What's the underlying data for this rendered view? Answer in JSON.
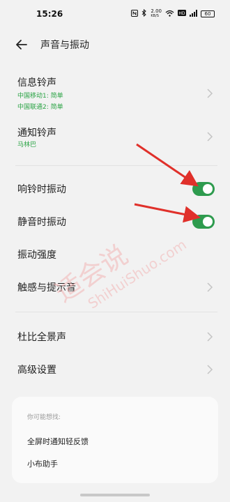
{
  "status_bar": {
    "time": "15:26",
    "speed_value": "2.00",
    "speed_unit": "KB/S",
    "battery": "60",
    "icons": [
      "nfc-icon",
      "bluetooth-icon",
      "wifi-icon",
      "hd-icon",
      "signal-icon",
      "battery-icon"
    ]
  },
  "header": {
    "title": "声音与振动"
  },
  "rows": {
    "message_ringtone": {
      "title": "信息铃声",
      "sub1": "中国移动1: 简单",
      "sub2": "中国联通2: 简单"
    },
    "notification_ringtone": {
      "title": "通知铃声",
      "sub": "马林巴"
    },
    "vibrate_on_ring": {
      "title": "响铃时振动",
      "on": true
    },
    "vibrate_on_silent": {
      "title": "静音时振动",
      "on": true
    },
    "vibration_strength": {
      "title": "振动强度"
    },
    "haptics_and_tones": {
      "title": "触感与提示音"
    },
    "dolby": {
      "title": "杜比全景声"
    },
    "advanced": {
      "title": "高级设置"
    }
  },
  "suggestions": {
    "heading": "你可能想找:",
    "items": [
      "全屏时通知轻反馈",
      "小布助手"
    ]
  },
  "watermark": {
    "cn": "适会说",
    "en": "ShiHuiShuo.com"
  },
  "colors": {
    "accent": "#2e9b4e",
    "sub_text": "#2aa344",
    "arrow": "#e0302a",
    "watermark": "#f2b5b5"
  }
}
